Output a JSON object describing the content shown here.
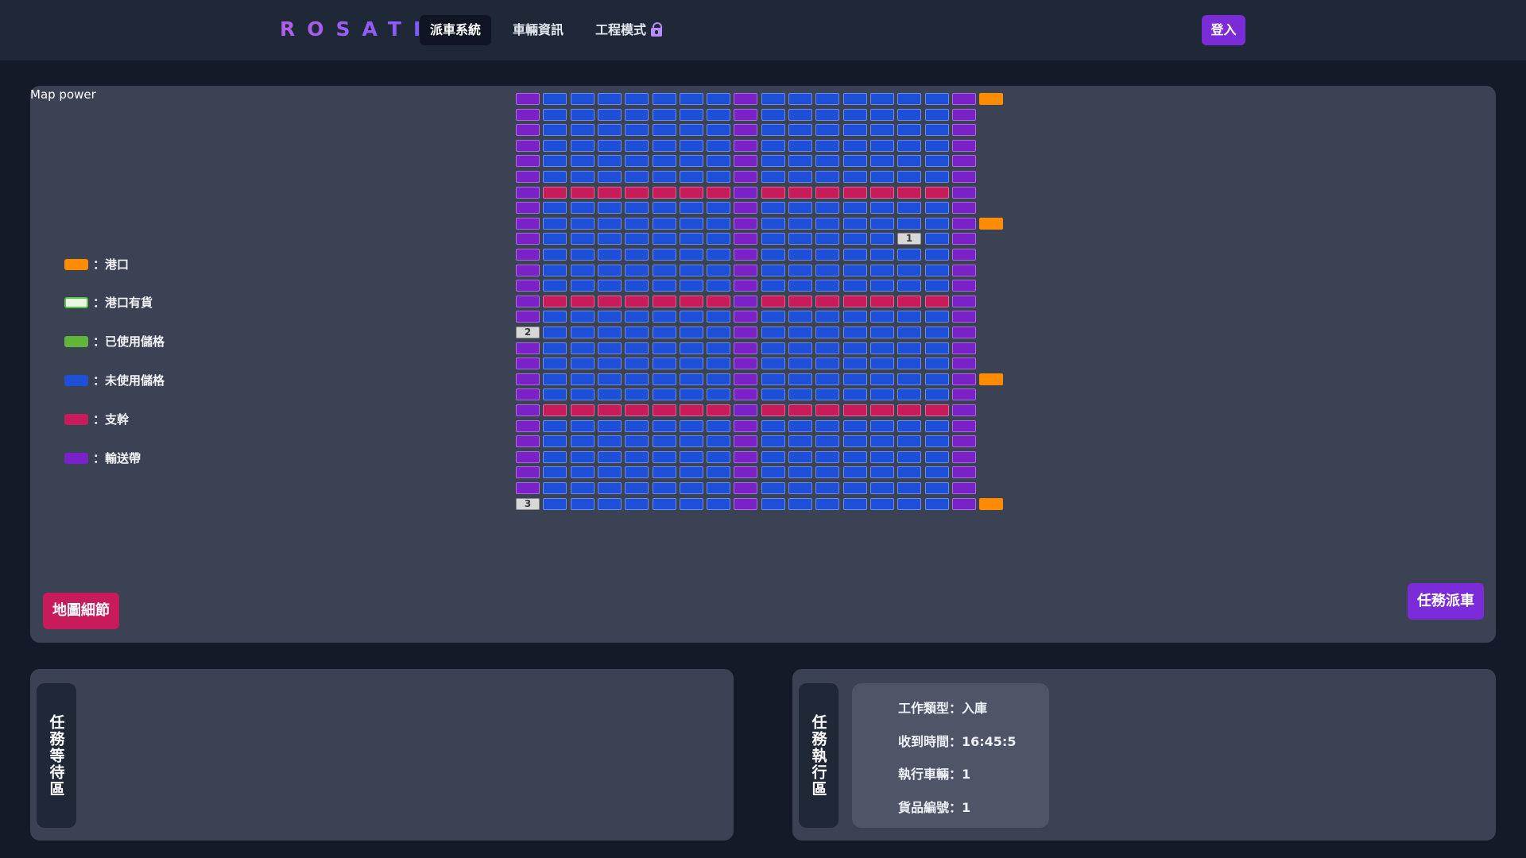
{
  "navbar": {
    "brand": "ROSATI",
    "links": [
      {
        "label": "派車系統",
        "active": true
      },
      {
        "label": "車輛資訊",
        "active": false
      },
      {
        "label": "工程模式",
        "active": false,
        "icon": "lock-icon"
      }
    ],
    "login_label": "登入"
  },
  "map": {
    "title": "Map power",
    "legend": [
      {
        "label": "：港口",
        "color": "#ff8c00",
        "style": "fill"
      },
      {
        "label": "：港口有貨",
        "color": "#5bc24a",
        "style": "outline"
      },
      {
        "label": "：已使用儲格",
        "color": "#62b53a",
        "style": "fill"
      },
      {
        "label": "：未使用儲格",
        "color": "#1e4fd8",
        "style": "fill"
      },
      {
        "label": "：支幹",
        "color": "#c81b5c",
        "style": "fill"
      },
      {
        "label": "：輸送帶",
        "color": "#7a22c8",
        "style": "fill"
      }
    ],
    "grid": {
      "rows": 27,
      "cols": 17,
      "conveyor_cols": [
        0,
        8,
        16
      ],
      "branch_rows": [
        6,
        13,
        20
      ],
      "port_rows": [
        0,
        8,
        18,
        26
      ],
      "vehicles": [
        {
          "label": "1",
          "row": 9,
          "col": 14
        },
        {
          "label": "2",
          "row": 15,
          "col": 0
        },
        {
          "label": "3",
          "row": 26,
          "col": 0
        }
      ]
    },
    "map_details_label": "地圖細節",
    "dispatch_label": "任務派車"
  },
  "colors": {
    "port": "#ff8c00",
    "unused": "#1e4fd8",
    "branch": "#c81b5c",
    "conveyor": "#7a22c8",
    "used": "#62b53a"
  },
  "waiting_area": {
    "label": "任務等待區"
  },
  "executing_area": {
    "label": "任務執行區",
    "task": {
      "work_type": "工作類型：入庫",
      "received_time": "收到時間：16:45:5",
      "vehicle": "執行車輛：1",
      "goods_id": "貨品編號：1"
    }
  }
}
